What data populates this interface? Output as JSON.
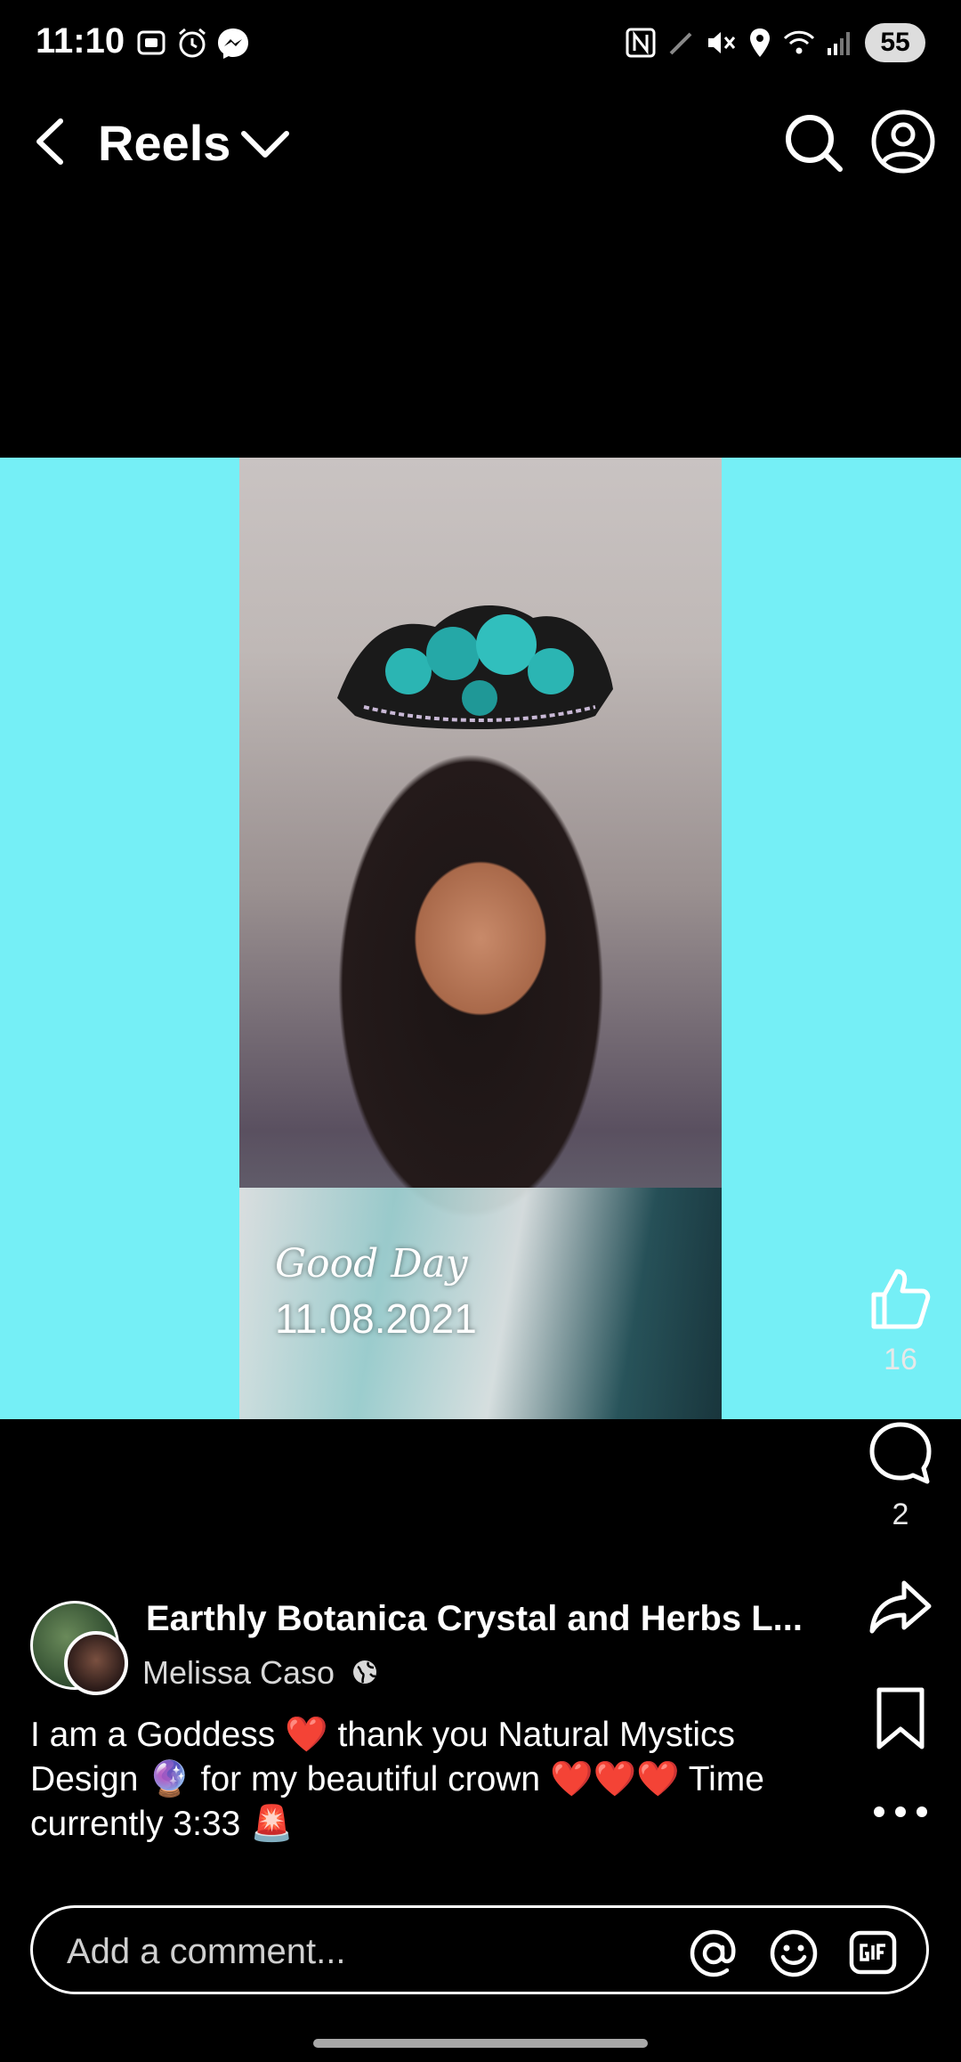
{
  "status_bar": {
    "time": "11:10",
    "battery": "55",
    "icons": [
      "screenshot-icon",
      "alarm-icon",
      "messenger-icon",
      "nfc-icon",
      "pen-icon",
      "mute-icon",
      "location-icon",
      "wifi-icon",
      "signal-icon"
    ]
  },
  "header": {
    "title": "Reels",
    "icons": [
      "back-icon",
      "chevron-down-icon",
      "search-icon",
      "profile-icon"
    ]
  },
  "media": {
    "overlay_line1": "Good Day",
    "overlay_line2": "11.08.2021",
    "side_color": "#75eff6"
  },
  "actions": {
    "like_count": "16",
    "comment_count": "2"
  },
  "post": {
    "page_name": "Earthly Botanica Crystal and Herbs L...",
    "author": "Melissa Caso",
    "caption": "I am a Goddess ❤️ thank you Natural Mystics Design 🔮 for my beautiful crown ❤️❤️❤️ Time currently 3:33 🚨"
  },
  "comment_box": {
    "placeholder": "Add a comment..."
  }
}
